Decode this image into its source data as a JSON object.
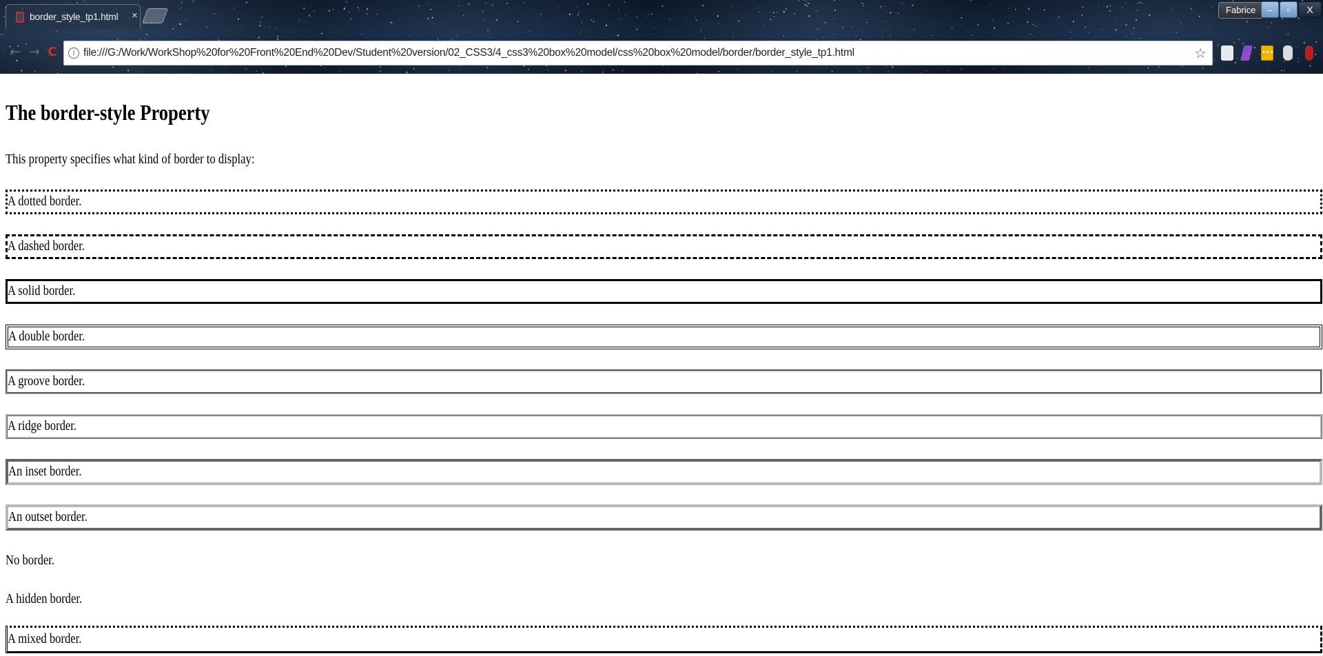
{
  "browser": {
    "tab_title": "border_style_tp1.html",
    "tab_close": "×",
    "user_name": "Fabrice",
    "window_controls": {
      "minimize": "–",
      "maximize": "▫",
      "close": "X"
    },
    "nav": {
      "back": "←",
      "forward": "→",
      "reload": "C"
    },
    "url": "file:///G:/Work/WorkShop%20for%20Front%20End%20Dev/Student%20version/02_CSS3/4_css3%20box%20model/css%20box%20model/border/border_style_tp1.html",
    "info_icon": "i",
    "star_icon": "☆",
    "extension_icons": [
      "extension-icon",
      "extension-icon",
      "extension-icon",
      "extension-icon",
      "extension-icon"
    ],
    "ext_menu_dots": "•••"
  },
  "page": {
    "heading": "The border-style Property",
    "intro": "This property specifies what kind of border to display:",
    "boxes": [
      "A dotted border.",
      "A dashed border.",
      "A solid border.",
      "A double border.",
      "A groove border.",
      "A ridge border.",
      "An inset border.",
      "An outset border.",
      "No border.",
      "A hidden border.",
      "A mixed border."
    ]
  }
}
